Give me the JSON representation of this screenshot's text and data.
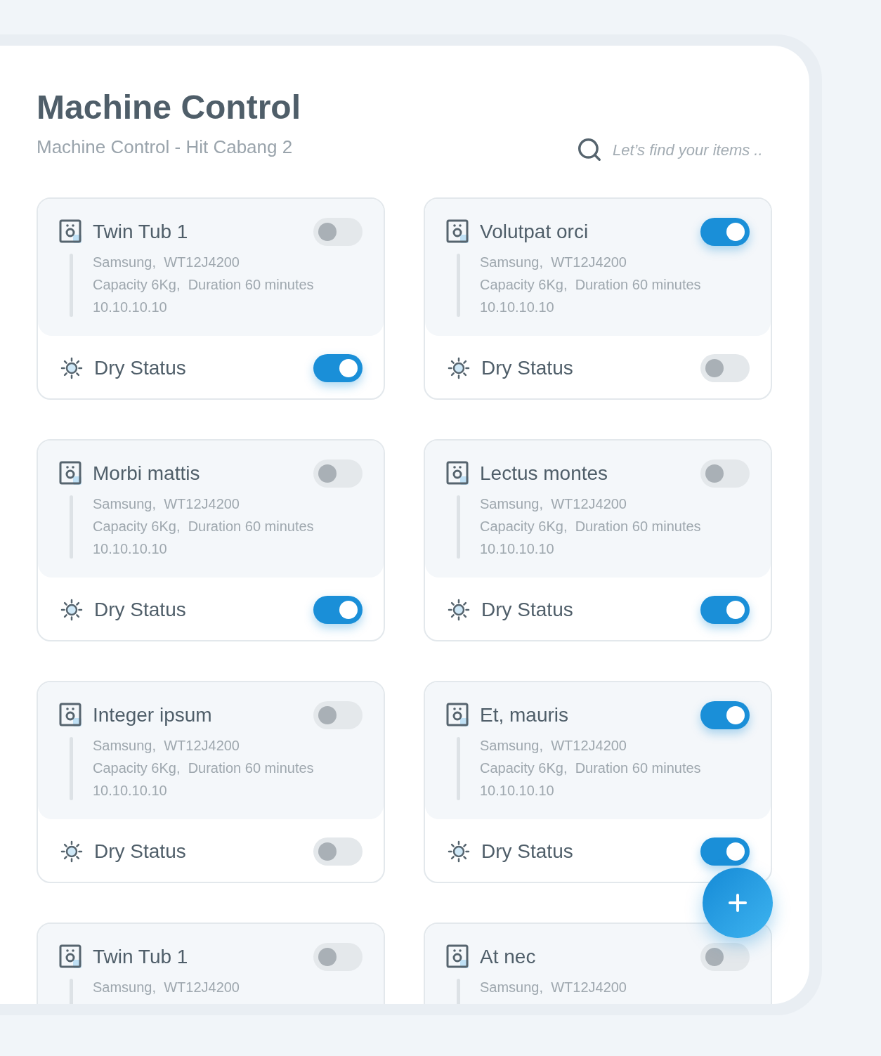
{
  "header": {
    "title": "Machine Control",
    "subtitle": "Machine Control - Hit Cabang 2"
  },
  "search": {
    "placeholder": "Let’s find your items .."
  },
  "machines": [
    {
      "name": "Twin Tub 1",
      "on": false,
      "details": [
        "Samsung,  WT12J4200",
        "Capacity 6Kg,  Duration 60 minutes",
        "10.10.10.10"
      ],
      "dry_status": {
        "label": "Dry Status",
        "on": true
      }
    },
    {
      "name": "Volutpat orci",
      "on": true,
      "details": [
        "Samsung,  WT12J4200",
        "Capacity 6Kg,  Duration 60 minutes",
        "10.10.10.10"
      ],
      "dry_status": {
        "label": "Dry Status",
        "on": false
      }
    },
    {
      "name": "Morbi mattis",
      "on": false,
      "details": [
        "Samsung,  WT12J4200",
        "Capacity 6Kg,  Duration 60 minutes",
        "10.10.10.10"
      ],
      "dry_status": {
        "label": "Dry Status",
        "on": true
      }
    },
    {
      "name": "Lectus montes",
      "on": false,
      "details": [
        "Samsung,  WT12J4200",
        "Capacity 6Kg,  Duration 60 minutes",
        "10.10.10.10"
      ],
      "dry_status": {
        "label": "Dry Status",
        "on": true
      }
    },
    {
      "name": "Integer ipsum",
      "on": false,
      "details": [
        "Samsung,  WT12J4200",
        "Capacity 6Kg,  Duration 60 minutes",
        "10.10.10.10"
      ],
      "dry_status": {
        "label": "Dry Status",
        "on": false
      }
    },
    {
      "name": "Et, mauris",
      "on": true,
      "details": [
        "Samsung,  WT12J4200",
        "Capacity 6Kg,  Duration 60 minutes",
        "10.10.10.10"
      ],
      "dry_status": {
        "label": "Dry Status",
        "on": true
      }
    },
    {
      "name": "Twin Tub 1",
      "on": false,
      "details": [
        "Samsung,  WT12J4200"
      ]
    },
    {
      "name": "At nec",
      "on": false,
      "details": [
        "Samsung,  WT12J4200"
      ]
    }
  ]
}
